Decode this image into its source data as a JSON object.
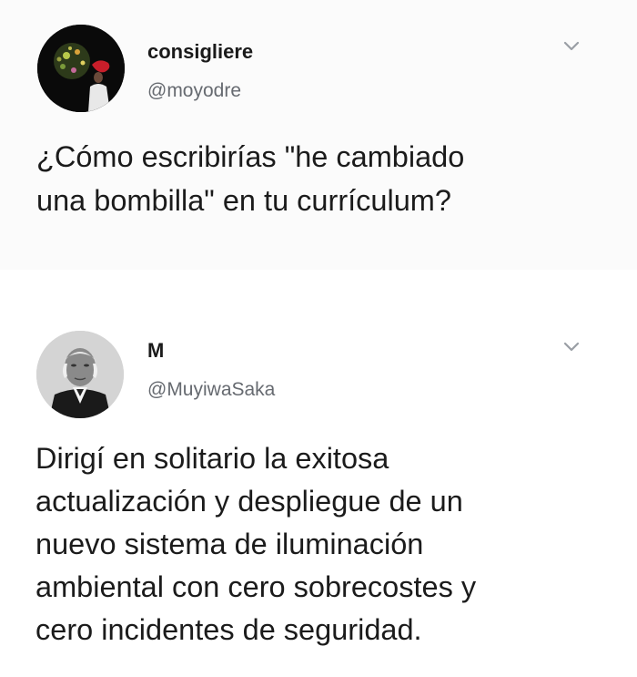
{
  "tweets": [
    {
      "display_name": "consigliere",
      "handle": "@moyodre",
      "text": "¿Cómo escribirías \"he cambiado\nuna bombilla\" en tu currículum?",
      "avatar_icon": "user-avatar-image",
      "menu_icon": "chevron-down-icon"
    },
    {
      "display_name": "M",
      "handle": "@MuyiwaSaka",
      "text": "Dirigí en solitario la exitosa\nactualización y despliegue de un\nnuevo sistema de iluminación\nambiental con cero sobrecostes y\ncero incidentes de seguridad.",
      "avatar_icon": "user-avatar-image",
      "menu_icon": "chevron-down-icon"
    }
  ],
  "colors": {
    "name": "#1a1a1a",
    "handle": "#666a70",
    "text": "#1b1b1b",
    "chevron": "#9a9fa5",
    "tweet1_bg": "#fbfbfb"
  }
}
